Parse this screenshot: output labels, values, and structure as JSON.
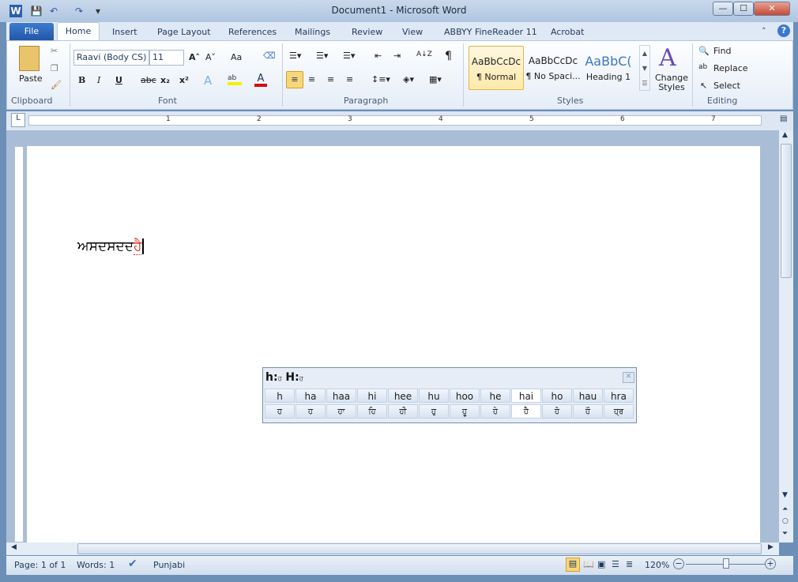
{
  "window": {
    "title": "Document1  -  Microsoft Word",
    "minimize": "—",
    "maximize": "☐",
    "close": "✕"
  },
  "qat": {
    "word_icon": "W",
    "save": "💾",
    "undo": "↶",
    "redo": "↷",
    "customize": "▾"
  },
  "tabs": [
    "File",
    "Home",
    "Insert",
    "Page Layout",
    "References",
    "Mailings",
    "Review",
    "View",
    "ABBYY FineReader 11",
    "Acrobat"
  ],
  "ribbon": {
    "clipboard": {
      "label": "Clipboard",
      "paste": "Paste"
    },
    "font": {
      "label": "Font",
      "name": "Raavi (Body CS)",
      "size": "11",
      "bold": "B",
      "italic": "I",
      "underline": "U",
      "strike": "abc",
      "sub": "x₂",
      "sup": "x²",
      "grow": "A˄",
      "shrink": "A˅",
      "case": "Aa"
    },
    "paragraph": {
      "label": "Paragraph",
      "pilcrow": "¶",
      "sort": "A↓Z"
    },
    "styles": {
      "label": "Styles",
      "items": [
        {
          "sample": "AaBbCcDc",
          "name": "¶ Normal"
        },
        {
          "sample": "AaBbCcDc",
          "name": "¶ No Spaci..."
        },
        {
          "sample": "AaBbC(",
          "name": "Heading 1"
        }
      ],
      "change_styles": "Change Styles"
    },
    "editing": {
      "label": "Editing",
      "find": "Find",
      "replace": "Replace",
      "select": "Select"
    }
  },
  "ruler": {
    "marks": [
      "1",
      "2",
      "3",
      "4",
      "5",
      "6",
      "7"
    ]
  },
  "document": {
    "text": "ਅਸਦਸਦਦ",
    "highlight": "ਹੈ",
    "highlight_color": "#e02020"
  },
  "ime": {
    "title_h": "h:",
    "title_h_char": "ਹ",
    "title_H": "H:",
    "title_H_char": "ਹ",
    "latin": [
      "h",
      "ha",
      "haa",
      "hi",
      "hee",
      "hu",
      "hoo",
      "he",
      "hai",
      "ho",
      "hau",
      "hra"
    ],
    "gurmukhi": [
      "ਹ",
      "ਹ",
      "ਹਾ",
      "ਹਿ",
      "ਹੀ",
      "ਹੁ",
      "ਹੂ",
      "ਹੇ",
      "ਹੈ",
      "ਹੋ",
      "ਹੌ",
      "ਹ੍ਰ"
    ],
    "selected_index": 8
  },
  "status": {
    "page": "Page: 1 of 1",
    "words": "Words: 1",
    "language": "Punjabi",
    "zoom": "120%"
  }
}
